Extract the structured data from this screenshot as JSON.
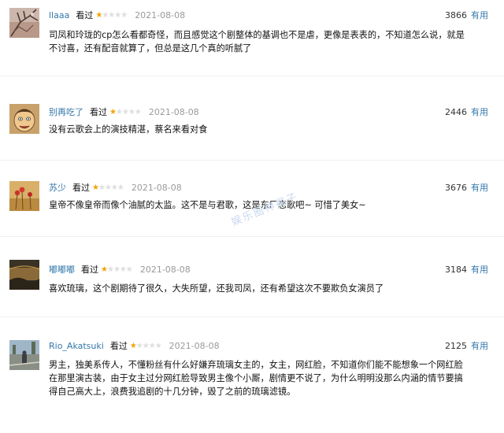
{
  "colors": {
    "link": "#3377aa",
    "star": "#f4a100",
    "date": "#9a9a9a"
  },
  "reviews": [
    {
      "user": "llaaa",
      "action": "看过",
      "stars_filled": 1,
      "stars_total": 5,
      "date": "2021-08-08",
      "votes": "3866",
      "useful": "有用",
      "lines": [
        "司凤和玲珑的cp怎么看都奇怪，而且感觉这个剧整体的基调也不是虐，更像是表表的，不知道怎么说，就是",
        "不讨喜，还有配音就算了，但总是这几个真的听腻了"
      ],
      "avatar": "branches-photo"
    },
    {
      "user": "别再吃了",
      "action": "看过",
      "stars_filled": 1,
      "stars_total": 5,
      "date": "2021-08-08",
      "votes": "2446",
      "useful": "有用",
      "lines": [
        "没有云歌会上的演技精湛，蔡名来看对食"
      ],
      "avatar": "cartoon-face"
    },
    {
      "user": "苏少",
      "action": "看过",
      "stars_filled": 1,
      "stars_total": 5,
      "date": "2021-08-08",
      "votes": "3676",
      "useful": "有用",
      "lines": [
        "皇帝不像皇帝而像个油腻的太监。这不是与君歌，这是东厂恋歌吧~ 可惜了美女~"
      ],
      "avatar": "red-flowers"
    },
    {
      "user": "嘟嘟嘟",
      "action": "看过",
      "stars_filled": 1,
      "stars_total": 5,
      "date": "2021-08-08",
      "votes": "3184",
      "useful": "有用",
      "lines": [
        "喜欢琉璃，这个剧期待了很久，大失所望，还我司凤，还有希望这次不要欺负女演员了"
      ],
      "avatar": "dark-landscape"
    },
    {
      "user": "Rio_Akatsuki",
      "action": "看过",
      "stars_filled": 1,
      "stars_total": 5,
      "date": "2021-08-08",
      "votes": "2125",
      "useful": "有用",
      "lines": [
        "男主，独美系传人，不懂粉丝有什么好嫌弃琉璃女主的，女主，网红脸，不知道你们能不能想象一个网红脸",
        "在那里演古装，由于女主过分网红脸导致男主像个小厮，剧情更不说了，为什么明明没那么内涵的情节要搞",
        "得自己高大上，浪费我追剧的十几分钟，毁了之前的琉璃滤镜。"
      ],
      "avatar": "street-photo"
    }
  ],
  "watermark": "娱乐圈神探子"
}
